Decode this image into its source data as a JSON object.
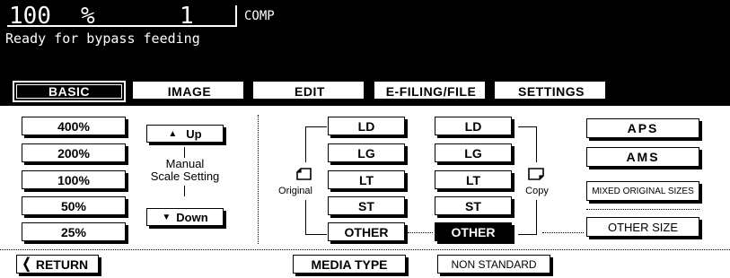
{
  "status": {
    "zoom_value": "100",
    "zoom_unit": "%",
    "copies": "1",
    "mode": "COMP",
    "message": "Ready for bypass feeding"
  },
  "tabs": [
    {
      "label": "BASIC",
      "active": true
    },
    {
      "label": "IMAGE",
      "active": false
    },
    {
      "label": "EDIT",
      "active": false
    },
    {
      "label": "E-FILING/FILE",
      "active": false
    },
    {
      "label": "SETTINGS",
      "active": false
    }
  ],
  "zoom_presets": [
    "400%",
    "200%",
    "100%",
    "50%",
    "25%"
  ],
  "manual_scale": {
    "up": "Up",
    "down": "Down",
    "label_line1": "Manual",
    "label_line2": "Scale Setting"
  },
  "original": {
    "label": "Original",
    "sizes": [
      "LD",
      "LG",
      "LT",
      "ST",
      "OTHER"
    ]
  },
  "copy": {
    "label": "Copy",
    "sizes": [
      "LD",
      "LG",
      "LT",
      "ST",
      "OTHER"
    ],
    "selected": "OTHER"
  },
  "right_buttons": {
    "aps": "APS",
    "ams": "AMS",
    "mixed": "MIXED ORIGINAL SIZES",
    "other_size": "OTHER SIZE"
  },
  "footer": {
    "return": "RETURN",
    "media_type": "MEDIA TYPE",
    "non_standard": "NON STANDARD"
  }
}
